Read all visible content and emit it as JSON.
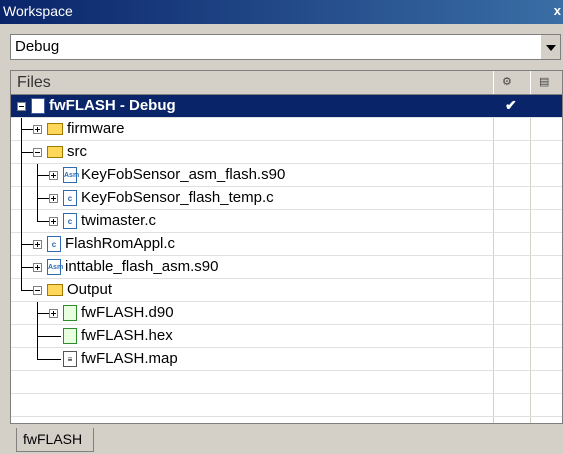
{
  "window": {
    "title": "Workspace",
    "close_label": "x"
  },
  "config_select": {
    "value": "Debug"
  },
  "tree": {
    "header": {
      "files_label": "Files"
    },
    "rows": [
      {
        "label": "fwFLASH - Debug",
        "check": "✔"
      },
      {
        "label": "firmware"
      },
      {
        "label": "src"
      },
      {
        "label": "KeyFobSensor_asm_flash.s90"
      },
      {
        "label": "KeyFobSensor_flash_temp.c"
      },
      {
        "label": "twimaster.c"
      },
      {
        "label": "FlashRomAppl.c"
      },
      {
        "label": "inttable_flash_asm.s90"
      },
      {
        "label": "Output"
      },
      {
        "label": "fwFLASH.d90"
      },
      {
        "label": "fwFLASH.hex"
      },
      {
        "label": "fwFLASH.map"
      }
    ]
  },
  "tabs": [
    {
      "label": "fwFLASH"
    }
  ],
  "icons": {
    "folder": "folder-icon",
    "c_file": "c-file-icon",
    "asm_file": "asm-file-icon",
    "workspace": "project-icon"
  }
}
